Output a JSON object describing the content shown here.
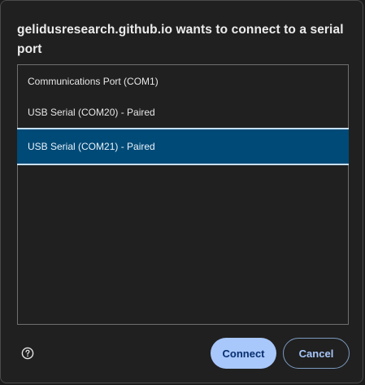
{
  "dialog": {
    "title": "gelidusresearch.github.io wants to connect to a serial port"
  },
  "ports": [
    {
      "label": "Communications Port (COM1)",
      "selected": false
    },
    {
      "label": "USB Serial (COM20) - Paired",
      "selected": false
    },
    {
      "label": "USB Serial (COM21) - Paired",
      "selected": true
    }
  ],
  "footer": {
    "help_icon": "question-circle-icon",
    "connect_label": "Connect",
    "cancel_label": "Cancel"
  },
  "colors": {
    "dialog_bg": "#202020",
    "selected_bg": "#004a77",
    "selected_border": "#c6dff2",
    "primary_button": "#a8c7fa",
    "primary_button_text": "#062e6f"
  }
}
